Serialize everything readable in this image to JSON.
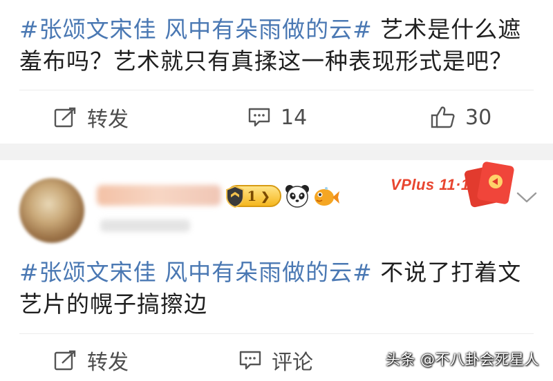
{
  "post1": {
    "hashtag": "#张颂文宋佳 风中有朵雨做的云#",
    "text": " 艺术是什么遮羞布吗？艺术就只有真揉这一种表现形式是吧？",
    "repost_label": "转发",
    "comment_count": "14",
    "like_count": "30"
  },
  "post2": {
    "level": "1",
    "badge_text": "VPlus 11·11",
    "hashtag": "#张颂文宋佳 风中有朵雨做的云#",
    "text": " 不说了打着文艺片的幌子搞擦边",
    "repost_label": "转发",
    "comment_label": "评论"
  },
  "watermark": "头条 @不八卦会死星人",
  "colors": {
    "hashtag": "#4a78b3",
    "badge_red": "#e8452f",
    "band": "#f2f2f2"
  }
}
